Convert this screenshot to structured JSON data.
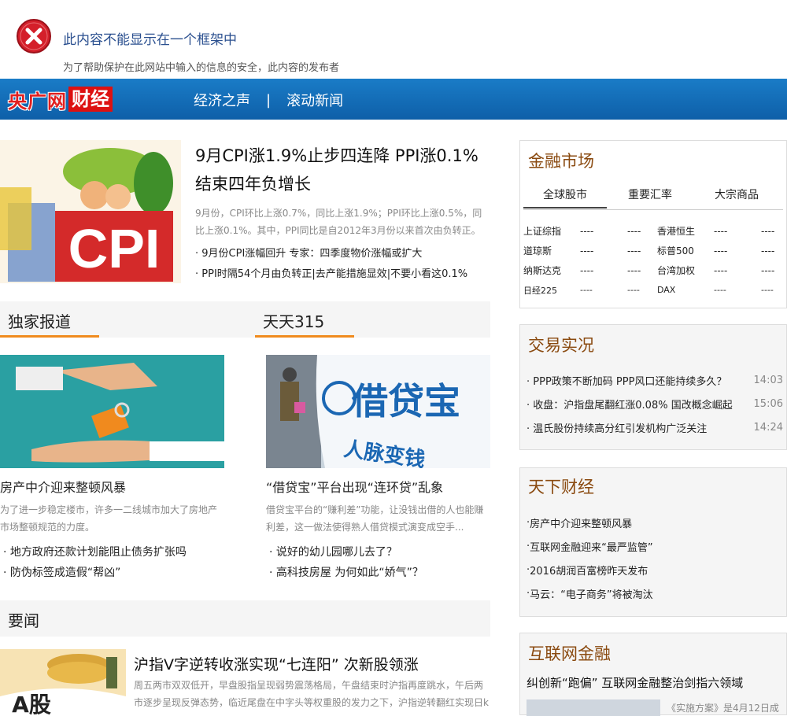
{
  "frame_error": {
    "title": "此内容不能显示在一个框架中",
    "message": "为了帮助保护在此网站中输入的信息的安全，此内容的发布者"
  },
  "nav": {
    "logo_part1": "央广网",
    "logo_part2": "财经",
    "links": [
      "经济之声",
      "滚动新闻"
    ],
    "separator": "|"
  },
  "lead": {
    "image_text": "CPI",
    "title": "9月CPI涨1.9%止步四连降 PPI涨0.1%结束四年负增长",
    "summary": "9月份，CPI环比上涨0.7%，同比上涨1.9%；PPI环比上涨0.5%，同比上涨0.1%。其中，PPI同比是自2012年3月份以来首次由负转正。",
    "bullets": [
      "9月份CPI涨幅回升 专家：四季度物价涨幅或扩大",
      "PPI时隔54个月由负转正|去产能措施显效|不要小看这0.1%"
    ]
  },
  "sections": {
    "exclusive": "独家报道",
    "daily315": "天天315",
    "news": "要闻"
  },
  "exclusive_story": {
    "title": "房产中介迎来整顿风暴",
    "summary": "为了进一步稳定楼市，许多一二线城市加大了房地产市场整顿规范的力度。",
    "bullets": [
      "地方政府还款计划能阻止债务扩张吗",
      "防伪标签成造假“帮凶”"
    ]
  },
  "daily315_story": {
    "image_text": "借贷宝",
    "image_subtext": "人脉变钱",
    "title": "“借贷宝”平台出现“连环贷”乱象",
    "summary": "借贷宝平台的“赚利差”功能，让没钱出借的人也能赚利差，这一做法使得熟人借贷模式演变成空手...",
    "bullets": [
      "说好的幼儿园哪儿去了？",
      "高科技房屋 为何如此“娇气”？"
    ]
  },
  "news_story": {
    "image_text": "A股",
    "title": "沪指V字逆转收涨实现“七连阳” 次新股领涨",
    "summary": "周五两市双双低开，早盘股指呈现弱势震荡格局，午盘结束时沪指再度跳水，午后两市逐步呈现反弹态势，临近尾盘在中字头等权重股的发力之下，沪指逆转翻红实现日k"
  },
  "market": {
    "title": "金融市场",
    "tabs": [
      "全球股市",
      "重要汇率",
      "大宗商品"
    ],
    "rows": [
      {
        "left": "上证综指",
        "right": "香港恒生",
        "v": "----"
      },
      {
        "left": "道琼斯",
        "right": "标普500",
        "v": "----"
      },
      {
        "left": "纳斯达克",
        "right": "台湾加权",
        "v": "----"
      },
      {
        "left": "日经225",
        "right": "DAX",
        "v": "----"
      }
    ]
  },
  "trade": {
    "title": "交易实况",
    "items": [
      {
        "text": "PPP政策不断加码 PPP风口还能持续多久？",
        "time": "14:03"
      },
      {
        "text": "收盘：沪指盘尾翻红涨0.08% 国改概念崛起",
        "time": "15:06"
      },
      {
        "text": "温氏股份持续高分红引发机构广泛关注",
        "time": "14:24"
      }
    ]
  },
  "finance": {
    "title": "天下财经",
    "items": [
      "房产中介迎来整顿风暴",
      "互联网金融迎来“最严监管”",
      "2016胡润百富榜昨天发布",
      "马云：“电子商务”将被淘汰"
    ]
  },
  "internet_finance": {
    "title": "互联网金融",
    "headline": "纠创新“跑偏” 互联网金融整治剑指六领域",
    "summary": "《实施方案》是4月12日成"
  },
  "colors": {
    "nav_blue": "#1a7cc7",
    "accent_orange": "#f08a1e",
    "box_title_brown": "#8a4a10",
    "error_red": "#d41f2a"
  }
}
